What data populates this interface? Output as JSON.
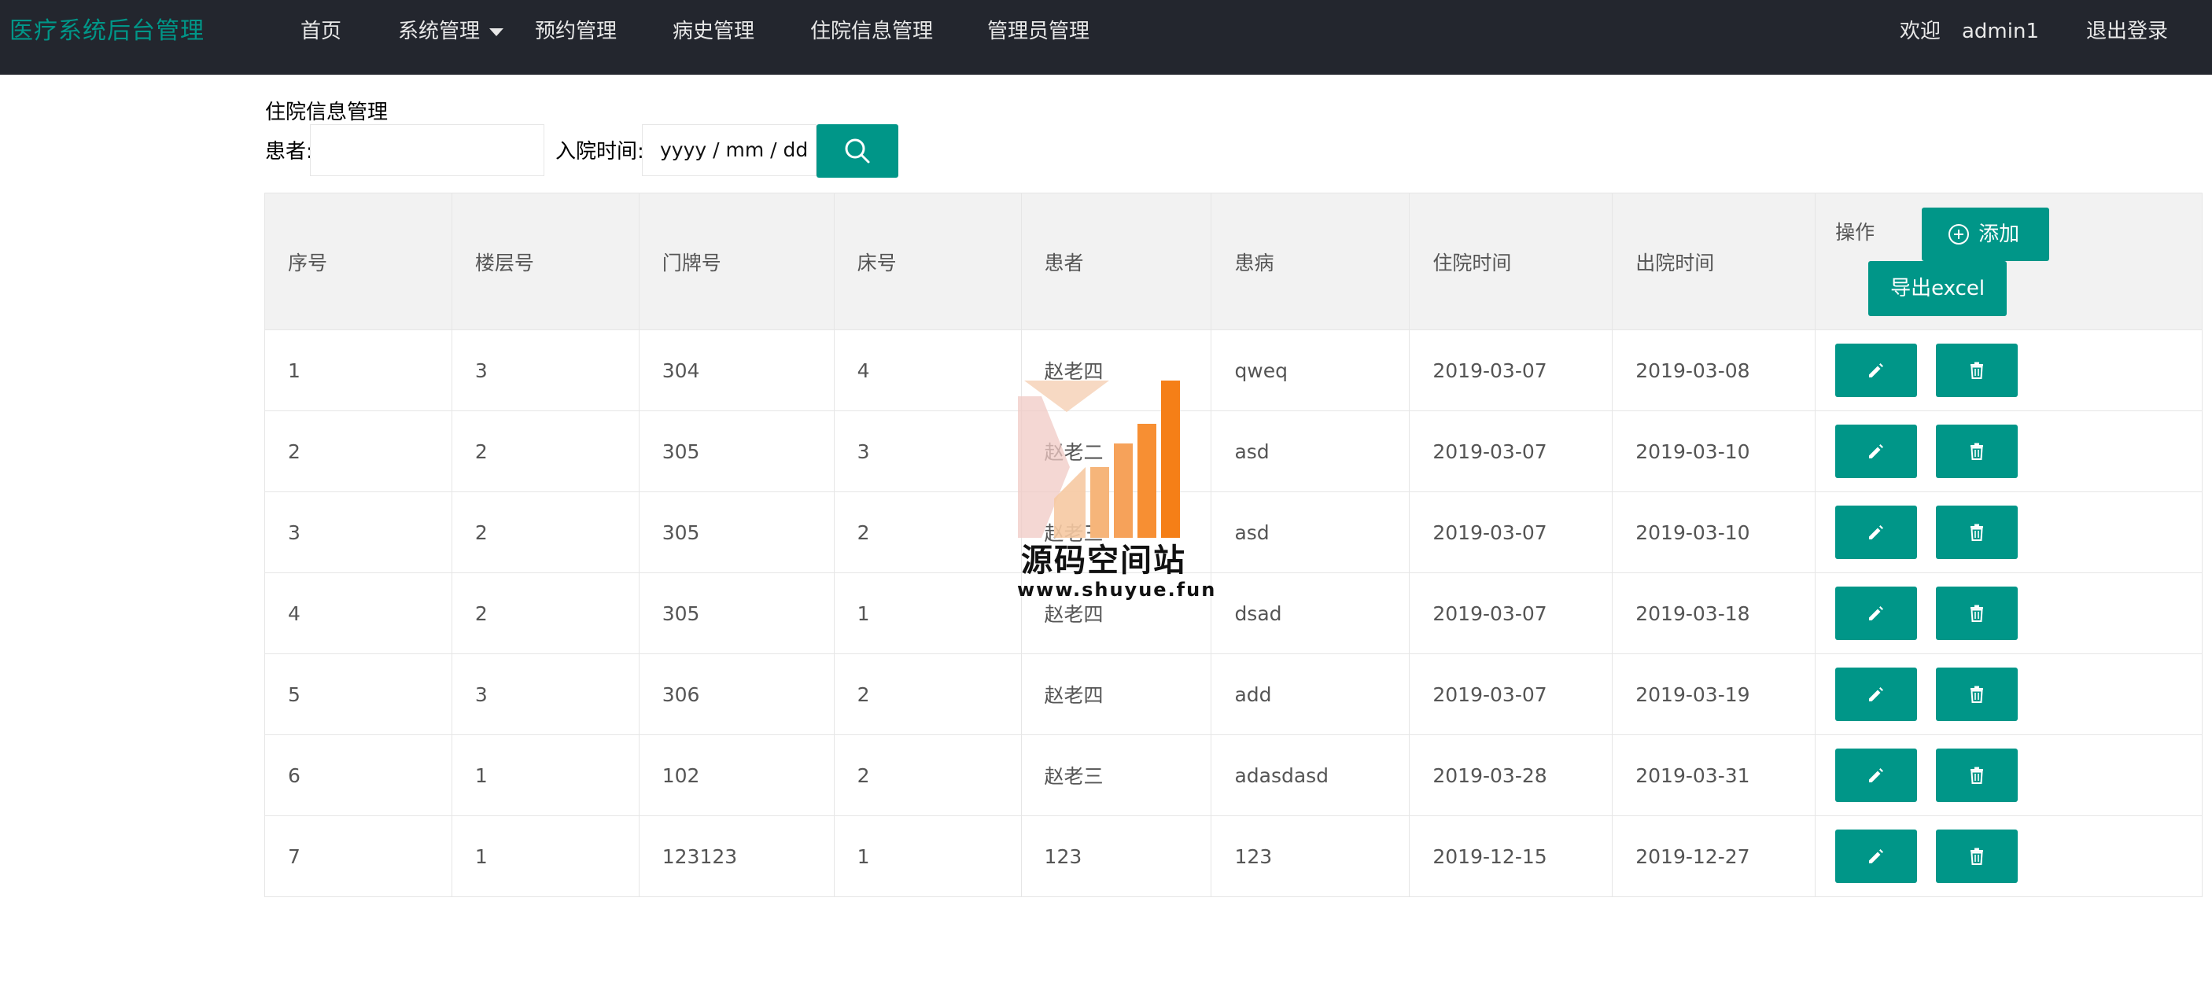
{
  "header": {
    "brand": "医疗系统后台管理",
    "nav": [
      {
        "label": "首页"
      },
      {
        "label": "系统管理"
      },
      {
        "label": "预约管理"
      },
      {
        "label": "病史管理"
      },
      {
        "label": "住院信息管理"
      },
      {
        "label": "管理员管理"
      }
    ],
    "welcome": "欢迎",
    "username": "admin1",
    "logout": "退出登录"
  },
  "page": {
    "title": "住院信息管理",
    "search": {
      "patient_label": "患者:",
      "patient_value": "",
      "admit_label": "入院时间:",
      "admit_placeholder": "yyyy / mm / dd"
    }
  },
  "table": {
    "columns": [
      "序号",
      "楼层号",
      "门牌号",
      "床号",
      "患者",
      "患病",
      "住院时间",
      "出院时间",
      "操作"
    ],
    "add_label": "添加",
    "export_label": "导出excel",
    "rows": [
      {
        "id": "1",
        "floor": "3",
        "room": "304",
        "bed": "4",
        "patient": "赵老四",
        "disease": "qweq",
        "admit": "2019-03-07",
        "discharge": "2019-03-08"
      },
      {
        "id": "2",
        "floor": "2",
        "room": "305",
        "bed": "3",
        "patient": "赵老二",
        "disease": "asd",
        "admit": "2019-03-07",
        "discharge": "2019-03-10"
      },
      {
        "id": "3",
        "floor": "2",
        "room": "305",
        "bed": "2",
        "patient": "赵老三",
        "disease": "asd",
        "admit": "2019-03-07",
        "discharge": "2019-03-10"
      },
      {
        "id": "4",
        "floor": "2",
        "room": "305",
        "bed": "1",
        "patient": "赵老四",
        "disease": "dsad",
        "admit": "2019-03-07",
        "discharge": "2019-03-18"
      },
      {
        "id": "5",
        "floor": "3",
        "room": "306",
        "bed": "2",
        "patient": "赵老四",
        "disease": "add",
        "admit": "2019-03-07",
        "discharge": "2019-03-19"
      },
      {
        "id": "6",
        "floor": "1",
        "room": "102",
        "bed": "2",
        "patient": "赵老三",
        "disease": "adasdasd",
        "admit": "2019-03-28",
        "discharge": "2019-03-31"
      },
      {
        "id": "7",
        "floor": "1",
        "room": "123123",
        "bed": "1",
        "patient": "123",
        "disease": "123",
        "admit": "2019-12-15",
        "discharge": "2019-12-27"
      }
    ],
    "row_actions": [
      "pencil-icon",
      "trash-icon"
    ]
  },
  "watermark": {
    "title": "源码空间站",
    "url": "www.shuyue.fun"
  },
  "colors": {
    "header_bg": "#23262e",
    "brand": "#009688",
    "primary_button": "#009688",
    "table_header_bg": "#f2f2f2"
  }
}
